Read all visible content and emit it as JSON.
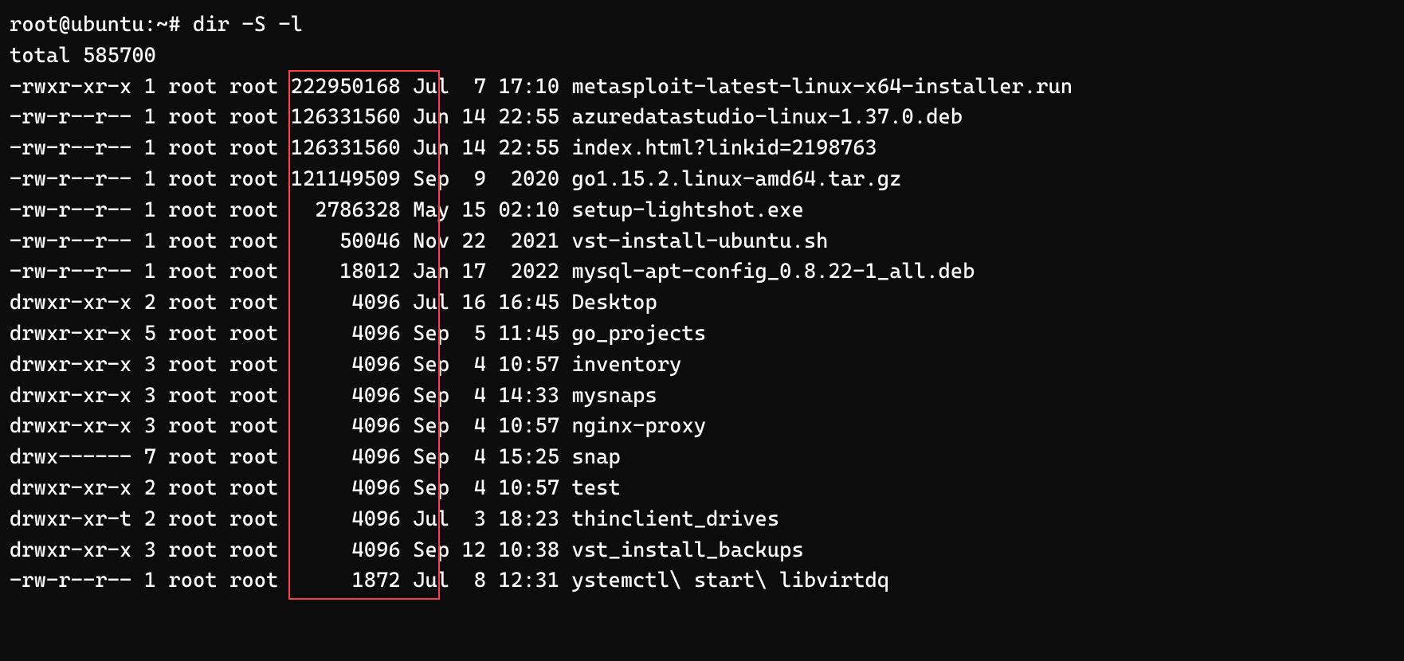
{
  "prompt": {
    "user": "root@ubuntu",
    "sep": ":",
    "cwd": "~",
    "mark": "#",
    "command": "dir -S -l"
  },
  "total_line": "total 585700",
  "rows": [
    {
      "perm": "-rwxr-xr-x",
      "links": "1",
      "owner": "root",
      "group": "root",
      "size": "222950168",
      "mon": "Jul",
      "day": "7",
      "time": "17:10",
      "name": "metasploit-latest-linux-x64-installer.run"
    },
    {
      "perm": "-rw-r--r--",
      "links": "1",
      "owner": "root",
      "group": "root",
      "size": "126331560",
      "mon": "Jun",
      "day": "14",
      "time": "22:55",
      "name": "azuredatastudio-linux-1.37.0.deb"
    },
    {
      "perm": "-rw-r--r--",
      "links": "1",
      "owner": "root",
      "group": "root",
      "size": "126331560",
      "mon": "Jun",
      "day": "14",
      "time": "22:55",
      "name": "index.html?linkid=2198763"
    },
    {
      "perm": "-rw-r--r--",
      "links": "1",
      "owner": "root",
      "group": "root",
      "size": "121149509",
      "mon": "Sep",
      "day": "9",
      "time": "2020",
      "name": "go1.15.2.linux-amd64.tar.gz"
    },
    {
      "perm": "-rw-r--r--",
      "links": "1",
      "owner": "root",
      "group": "root",
      "size": "2786328",
      "mon": "May",
      "day": "15",
      "time": "02:10",
      "name": "setup-lightshot.exe"
    },
    {
      "perm": "-rw-r--r--",
      "links": "1",
      "owner": "root",
      "group": "root",
      "size": "50046",
      "mon": "Nov",
      "day": "22",
      "time": "2021",
      "name": "vst-install-ubuntu.sh"
    },
    {
      "perm": "-rw-r--r--",
      "links": "1",
      "owner": "root",
      "group": "root",
      "size": "18012",
      "mon": "Jan",
      "day": "17",
      "time": "2022",
      "name": "mysql-apt-config_0.8.22-1_all.deb"
    },
    {
      "perm": "drwxr-xr-x",
      "links": "2",
      "owner": "root",
      "group": "root",
      "size": "4096",
      "mon": "Jul",
      "day": "16",
      "time": "16:45",
      "name": "Desktop"
    },
    {
      "perm": "drwxr-xr-x",
      "links": "5",
      "owner": "root",
      "group": "root",
      "size": "4096",
      "mon": "Sep",
      "day": "5",
      "time": "11:45",
      "name": "go_projects"
    },
    {
      "perm": "drwxr-xr-x",
      "links": "3",
      "owner": "root",
      "group": "root",
      "size": "4096",
      "mon": "Sep",
      "day": "4",
      "time": "10:57",
      "name": "inventory"
    },
    {
      "perm": "drwxr-xr-x",
      "links": "3",
      "owner": "root",
      "group": "root",
      "size": "4096",
      "mon": "Sep",
      "day": "4",
      "time": "14:33",
      "name": "mysnaps"
    },
    {
      "perm": "drwxr-xr-x",
      "links": "3",
      "owner": "root",
      "group": "root",
      "size": "4096",
      "mon": "Sep",
      "day": "4",
      "time": "10:57",
      "name": "nginx-proxy"
    },
    {
      "perm": "drwx------",
      "links": "7",
      "owner": "root",
      "group": "root",
      "size": "4096",
      "mon": "Sep",
      "day": "4",
      "time": "15:25",
      "name": "snap"
    },
    {
      "perm": "drwxr-xr-x",
      "links": "2",
      "owner": "root",
      "group": "root",
      "size": "4096",
      "mon": "Sep",
      "day": "4",
      "time": "10:57",
      "name": "test"
    },
    {
      "perm": "drwxr-xr-t",
      "links": "2",
      "owner": "root",
      "group": "root",
      "size": "4096",
      "mon": "Jul",
      "day": "3",
      "time": "18:23",
      "name": "thinclient_drives"
    },
    {
      "perm": "drwxr-xr-x",
      "links": "3",
      "owner": "root",
      "group": "root",
      "size": "4096",
      "mon": "Sep",
      "day": "12",
      "time": "10:38",
      "name": "vst_install_backups"
    },
    {
      "perm": "-rw-r--r--",
      "links": "1",
      "owner": "root",
      "group": "root",
      "size": "1872",
      "mon": "Jul",
      "day": "8",
      "time": "12:31",
      "name": "ystemctl\\ start\\ libvirtdq"
    }
  ],
  "highlight": {
    "col_start": 23,
    "col_end": 34,
    "row_start": 2,
    "row_end": 18
  }
}
